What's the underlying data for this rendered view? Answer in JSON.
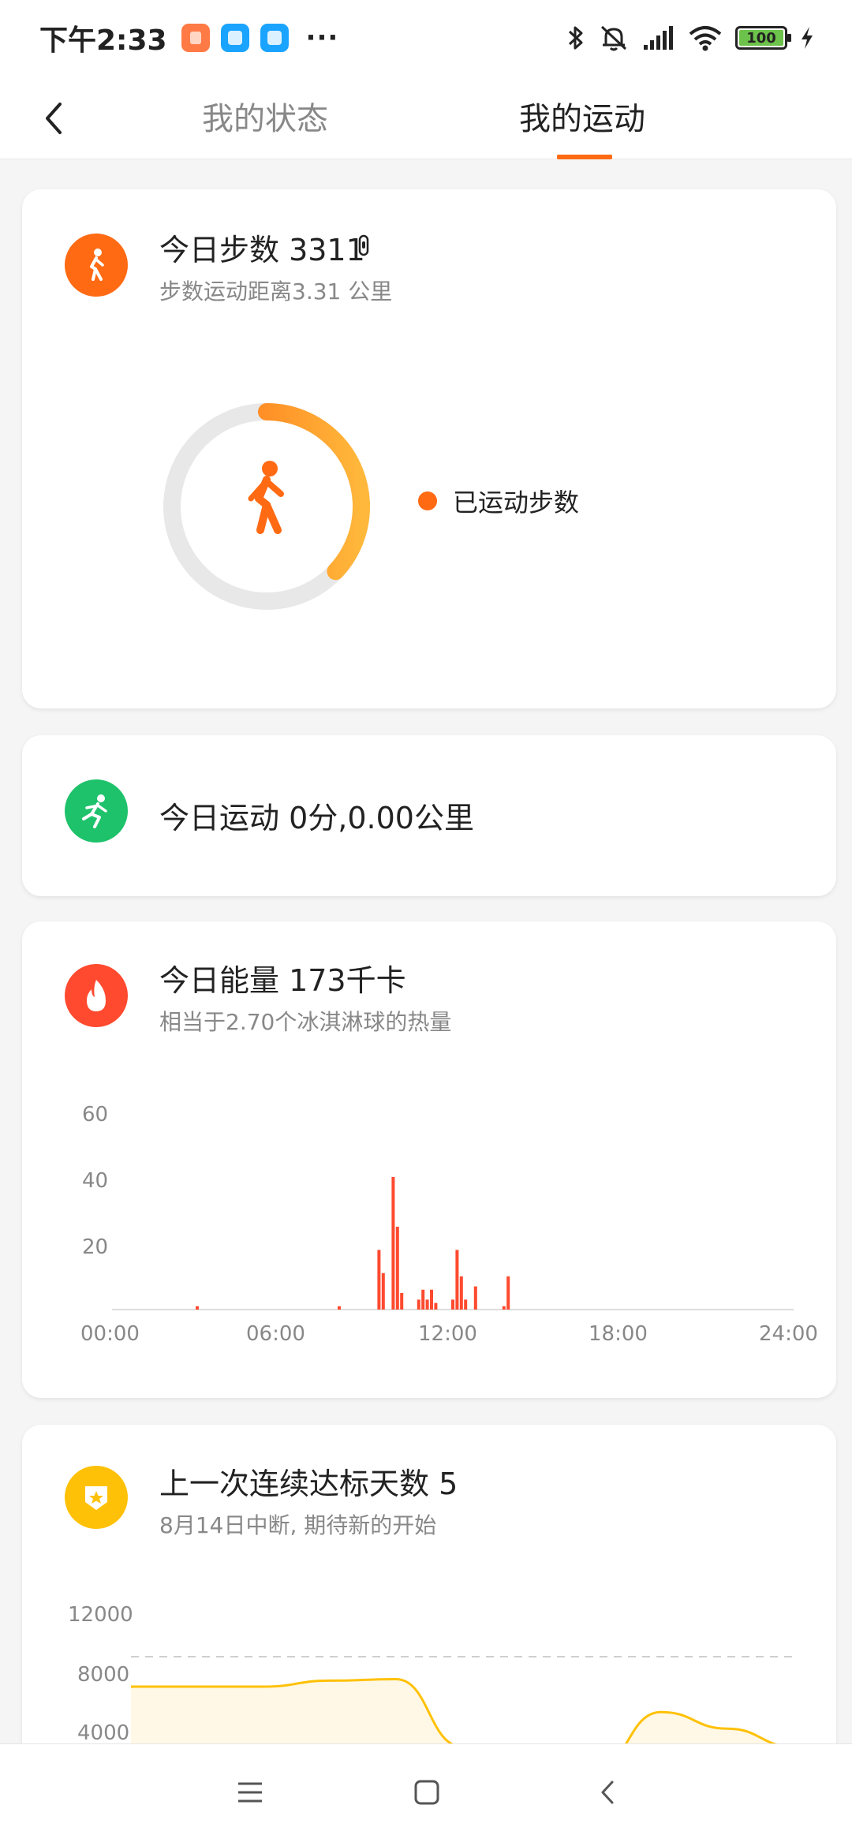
{
  "status_bar": {
    "time": "下午2:33",
    "overflow": "···",
    "battery": "100",
    "icons": [
      "bluetooth-icon",
      "mute-icon",
      "signal-icon",
      "wifi-icon",
      "battery-icon",
      "charging-icon"
    ]
  },
  "nav": {
    "tabs": [
      {
        "label": "我的状态",
        "active": false
      },
      {
        "label": "我的运动",
        "active": true
      }
    ],
    "accent": "#ff6a13"
  },
  "steps_card": {
    "title": "今日步数 3311",
    "subtitle": "步数运动距离3.31 公里",
    "legend": "已运动步数",
    "progress": 0.37,
    "icon": "walking-icon",
    "color": "#ff6a13"
  },
  "workout_card": {
    "title": "今日运动 0分,0.00公里",
    "icon": "running-icon",
    "color": "#1ec26b"
  },
  "energy_card": {
    "title": "今日能量 173千卡",
    "subtitle": "相当于2.70个冰淇淋球的热量",
    "icon": "flame-icon",
    "color": "#ff4a2f"
  },
  "streak_card": {
    "title": "上一次连续达标天数 5",
    "subtitle": "8月14日中断, 期待新的开始",
    "icon": "badge-icon",
    "color": "#ffc107"
  },
  "chart_data": [
    {
      "type": "bar",
      "x_ticks": [
        "00:00",
        "06:00",
        "12:00",
        "18:00",
        "24:00"
      ],
      "y_ticks": [
        "60",
        "40",
        "20"
      ],
      "ylim": [
        0,
        60
      ],
      "xlim_hours": [
        0,
        24
      ],
      "grid": false,
      "color": "#ff4a2f",
      "bars": [
        {
          "hour": 3.0,
          "value": 1
        },
        {
          "hour": 8.0,
          "value": 1
        },
        {
          "hour": 9.4,
          "value": 18
        },
        {
          "hour": 9.55,
          "value": 11
        },
        {
          "hour": 9.9,
          "value": 40
        },
        {
          "hour": 10.05,
          "value": 25
        },
        {
          "hour": 10.2,
          "value": 5
        },
        {
          "hour": 10.8,
          "value": 3
        },
        {
          "hour": 10.95,
          "value": 6
        },
        {
          "hour": 11.1,
          "value": 3
        },
        {
          "hour": 11.25,
          "value": 6
        },
        {
          "hour": 11.4,
          "value": 2
        },
        {
          "hour": 12.0,
          "value": 3
        },
        {
          "hour": 12.15,
          "value": 18
        },
        {
          "hour": 12.3,
          "value": 10
        },
        {
          "hour": 12.45,
          "value": 3
        },
        {
          "hour": 12.8,
          "value": 7
        },
        {
          "hour": 13.8,
          "value": 1
        },
        {
          "hour": 13.95,
          "value": 10
        }
      ]
    },
    {
      "type": "area",
      "y_ticks": [
        "12000",
        "8000",
        "4000"
      ],
      "ylim": [
        4000,
        12000
      ],
      "goal": 10000,
      "color": "#ffc107",
      "x": [
        0,
        1,
        2,
        3,
        4,
        5,
        6,
        7,
        8,
        9,
        10
      ],
      "values": [
        8000,
        8000,
        8000,
        8400,
        8500,
        4000,
        2000,
        2500,
        6300,
        5200,
        4000
      ]
    }
  ]
}
